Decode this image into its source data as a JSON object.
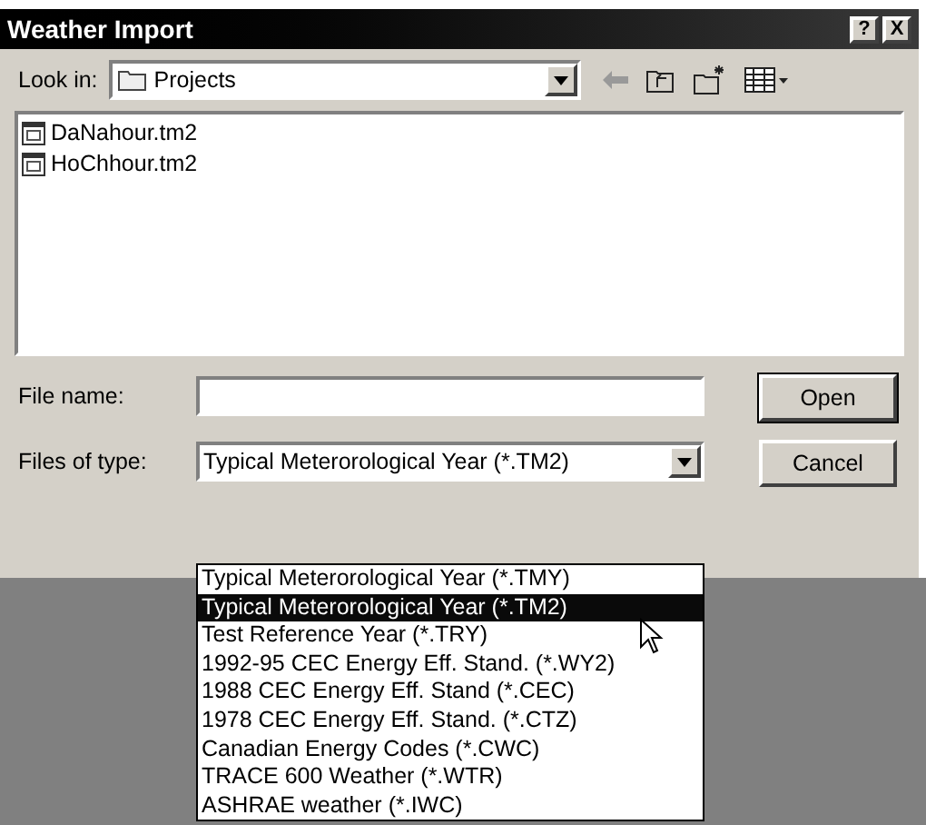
{
  "window": {
    "title": "Weather Import",
    "help_button": "?",
    "close_button": "X"
  },
  "look_in": {
    "label": "Look in:",
    "value": "Projects"
  },
  "files": [
    {
      "name": "DaNahour.tm2"
    },
    {
      "name": "HoChhour.tm2"
    }
  ],
  "file_name": {
    "label": "File name:"
  },
  "files_of_type": {
    "label": "Files of type:",
    "value": "Typical Meterorological Year (*.TM2)",
    "expanded": true,
    "options": [
      {
        "label": "Typical Meterorological Year (*.TMY)",
        "selected": false
      },
      {
        "label": "Typical Meterorological Year (*.TM2)",
        "selected": true
      },
      {
        "label": "Test Reference Year (*.TRY)",
        "selected": false
      },
      {
        "label": "1992-95 CEC Energy Eff. Stand. (*.WY2)",
        "selected": false
      },
      {
        "label": "1988 CEC Energy Eff. Stand (*.CEC)",
        "selected": false
      },
      {
        "label": "1978 CEC Energy Eff. Stand. (*.CTZ)",
        "selected": false
      },
      {
        "label": "Canadian Energy Codes (*.CWC)",
        "selected": false
      },
      {
        "label": "TRACE 600 Weather (*.WTR)",
        "selected": false
      },
      {
        "label": "ASHRAE weather (*.IWC)",
        "selected": false
      }
    ]
  },
  "buttons": [
    {
      "label": "Open"
    },
    {
      "label": "Cancel"
    }
  ]
}
